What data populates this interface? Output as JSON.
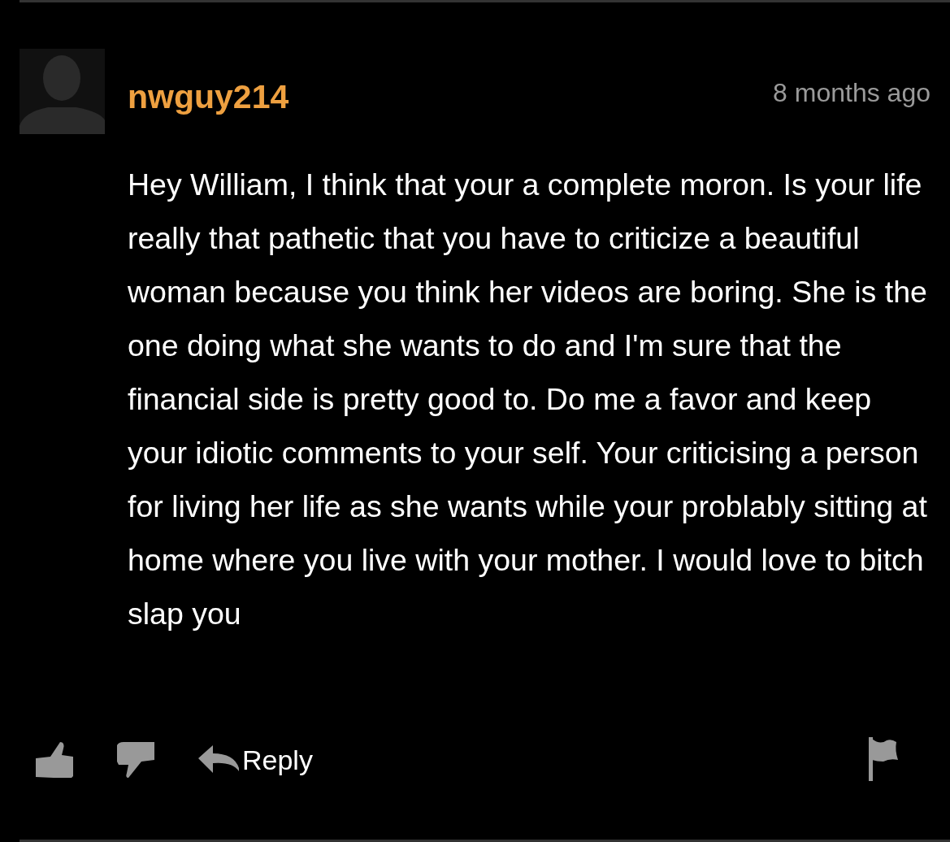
{
  "comment": {
    "username": "nwguy214",
    "time": "8 months ago",
    "text": "Hey William, I think that your a complete moron. Is your life really that pathetic that you have to criticize a beautiful woman because you think her videos are boring. She is the one doing what she wants to do and I'm sure that the financial side is pretty good to. Do me a favor and keep your idiotic comments to your self. Your criticising a person for living her life as she wants while your problably sitting at home where you live with your mother. I would love to bitch slap you",
    "reply_label": "Reply"
  }
}
